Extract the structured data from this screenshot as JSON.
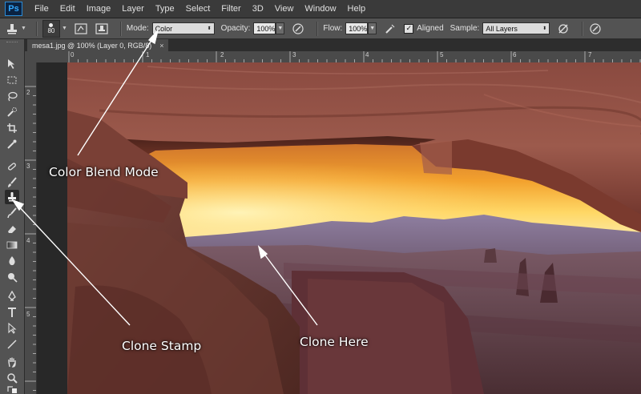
{
  "app": {
    "logo": "Ps"
  },
  "menu": [
    "File",
    "Edit",
    "Image",
    "Layer",
    "Type",
    "Select",
    "Filter",
    "3D",
    "View",
    "Window",
    "Help"
  ],
  "options": {
    "brush_size": "80",
    "mode_label": "Mode:",
    "mode_value": "Color",
    "opacity_label": "Opacity:",
    "opacity_value": "100%",
    "flow_label": "Flow:",
    "flow_value": "100%",
    "aligned_label": "Aligned",
    "aligned_checked": true,
    "sample_label": "Sample:",
    "sample_value": "All Layers"
  },
  "document": {
    "tab_title": "mesa1.jpg @ 100% (Layer 0, RGB/8)",
    "tab_close": "×"
  },
  "rulers": {
    "top": [
      "0",
      "1",
      "2",
      "3",
      "4",
      "5",
      "6",
      "7"
    ],
    "left": [
      "2",
      "3",
      "4",
      "5"
    ]
  },
  "annotations": {
    "color_blend": "Color Blend Mode",
    "clone_stamp": "Clone Stamp",
    "clone_here": "Clone Here"
  },
  "tools": [
    "move-tool-icon",
    "marquee-tool-icon",
    "lasso-tool-icon",
    "quick-select-icon",
    "crop-tool-icon",
    "eyedropper-icon",
    "spot-healing-icon",
    "brush-tool-icon",
    "clone-stamp-icon",
    "history-brush-icon",
    "eraser-icon",
    "gradient-icon",
    "blur-icon",
    "dodge-icon",
    "pen-tool-icon",
    "type-tool-icon",
    "path-select-icon",
    "line-tool-icon",
    "hand-tool-icon",
    "zoom-tool-icon"
  ]
}
